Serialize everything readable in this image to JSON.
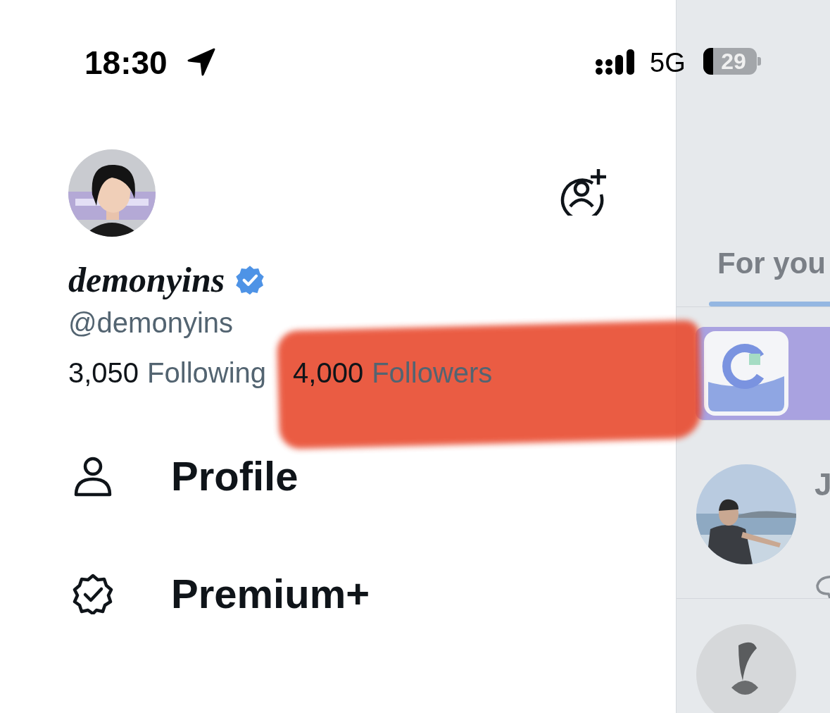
{
  "status_bar": {
    "time": "18:30",
    "network": "5G",
    "battery": "29"
  },
  "drawer": {
    "account": {
      "display_name": "demonyins",
      "verified": true,
      "handle": "@demonyins",
      "following_count": "3,050",
      "following_label": "Following",
      "followers_count": "4,000",
      "followers_label": "Followers"
    },
    "menu": [
      {
        "label": "Profile",
        "kind": "profile"
      },
      {
        "label": "Premium+",
        "kind": "premium"
      }
    ]
  },
  "feed": {
    "tabs": [
      {
        "label": "For you",
        "selected": true
      }
    ],
    "posts": [
      {
        "kind": "promo"
      },
      {
        "kind": "post",
        "author": "J"
      },
      {
        "kind": "post"
      }
    ]
  },
  "annotation": {
    "kind": "scribble"
  }
}
